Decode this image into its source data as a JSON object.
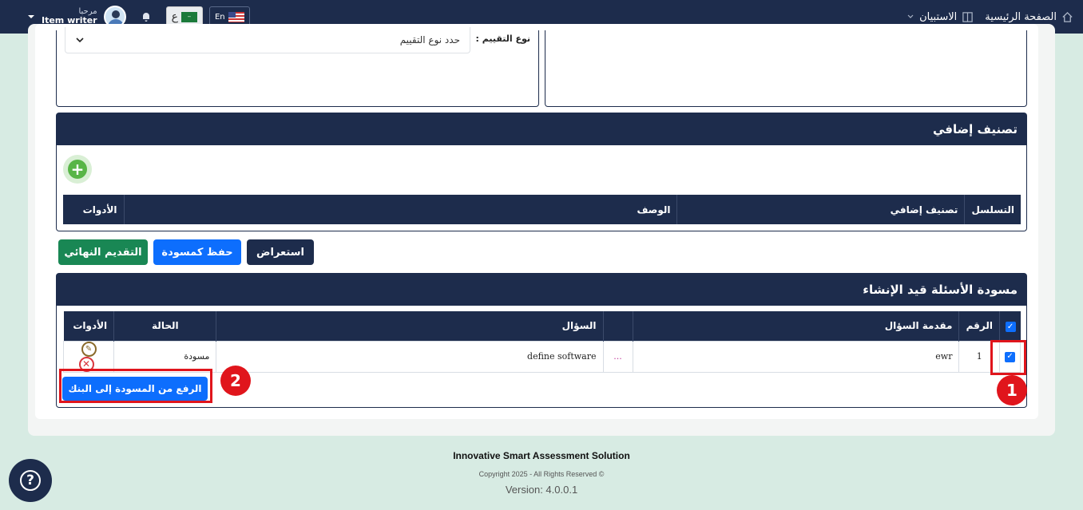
{
  "navbar": {
    "home_label": "الصفحة الرئيسية",
    "survey_label": "الاستبيان",
    "lang_en": "En",
    "lang_ar": "ع",
    "greeting": "مرحبا",
    "username": "Item writer"
  },
  "assessment": {
    "label": "نوع التقييم :",
    "select_placeholder": "حدد نوع التقييم"
  },
  "extra_classification": {
    "title": "تصنيف إضافي",
    "columns": [
      "التسلسل",
      "تصنيف إضافي",
      "الوصف",
      "الأدوات"
    ]
  },
  "actions": {
    "preview": "استعراض",
    "save_draft": "حفظ كمسودة",
    "final_submit": "التقديم النهائي"
  },
  "drafts": {
    "title": "مسودة الأسئلة قيد الإنشاء",
    "columns": [
      "الرقم",
      "مقدمة السؤال",
      "السؤال",
      "الحالة",
      "الأدوات"
    ],
    "rows": [
      {
        "number": "1",
        "intro": "ewr",
        "more": "...",
        "question": "define software",
        "status": "مسودة"
      }
    ],
    "upload_button": "الرفع من المسودة إلى البنك"
  },
  "annotations": {
    "badge1": "1",
    "badge2": "2"
  },
  "footer": {
    "title": "Innovative Smart Assessment Solution",
    "copyright": "Copyright 2025 - All Rights Reserved ©",
    "version": "Version: 4.0.0.1"
  },
  "colors": {
    "navy": "#1d2c4c",
    "primary": "#0d6efd",
    "success": "#198754",
    "danger": "#e0151c"
  }
}
